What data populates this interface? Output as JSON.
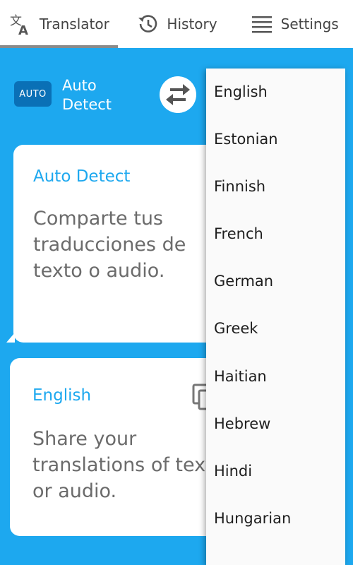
{
  "tabs": [
    {
      "label": "Translator",
      "icon": "translate-icon",
      "active": true
    },
    {
      "label": "History",
      "icon": "history-icon",
      "active": false
    },
    {
      "label": "Settings",
      "icon": "menu-icon",
      "active": false
    }
  ],
  "language_row": {
    "auto_badge": "AUTO",
    "source_language": "Auto Detect",
    "swap_icon": "swap-arrows-icon"
  },
  "source_card": {
    "language": "Auto Detect",
    "text": "Comparte tus traducciones de texto o audio."
  },
  "target_card": {
    "language": "English",
    "text": "Share your translations of text or audio.",
    "copy_icon": "copy-icon"
  },
  "dropdown": {
    "items": [
      "English",
      "Estonian",
      "Finnish",
      "French",
      "German",
      "Greek",
      "Haitian",
      "Hebrew",
      "Hindi",
      "Hungarian"
    ]
  },
  "colors": {
    "accent": "#1da8ef",
    "badge": "#0a70b6"
  }
}
